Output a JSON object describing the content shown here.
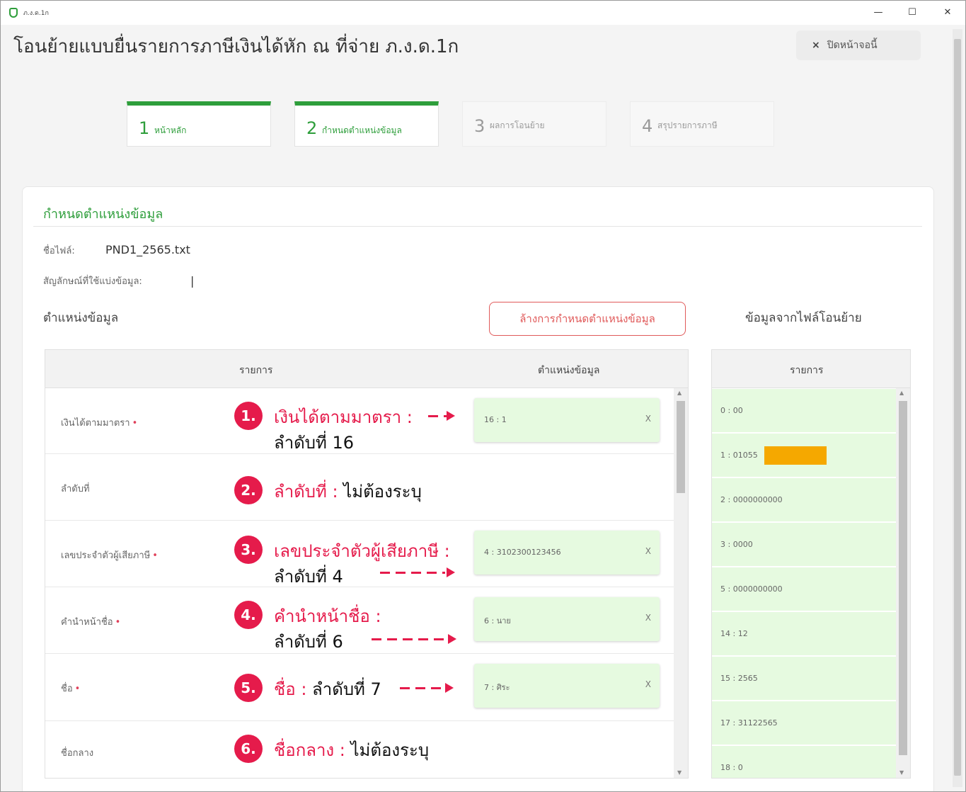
{
  "window": {
    "app_title": "ภ.ง.ด.1ก",
    "minimize": "—",
    "maximize": "☐",
    "close": "✕"
  },
  "page": {
    "title": "โอนย้ายแบบยื่นรายการภาษีเงินได้หัก ณ ที่จ่าย ภ.ง.ด.1ก",
    "close_button": "ปิดหน้าจอนี้",
    "close_icon": "×"
  },
  "steps": [
    {
      "num": "1",
      "label": "หน้าหลัก"
    },
    {
      "num": "2",
      "label": "กำหนดตำแหน่งข้อมูล"
    },
    {
      "num": "3",
      "label": "ผลการโอนย้าย"
    },
    {
      "num": "4",
      "label": "สรุปรายการภาษี"
    }
  ],
  "section": {
    "title": "กำหนดตำแหน่งข้อมูล",
    "file_label": "ชื่อไฟล์:",
    "file_name": "PND1_2565.txt",
    "delimiter_label": "สัญลักษณ์ที่ใช้แบ่งข้อมูล:",
    "delimiter_value": "|",
    "positions_heading": "ตำแหน่งข้อมูล",
    "clear_button": "ล้างการกำหนดตำแหน่งข้อมูล",
    "source_heading": "ข้อมูลจากไฟล์โอนย้าย"
  },
  "mapping_table": {
    "col_item": "รายการ",
    "col_position": "ตำแหน่งข้อมูล",
    "required_mark": "•",
    "rows": [
      {
        "label": "เงินได้ตามมาตรา",
        "required": true,
        "slot": "16 : 1",
        "remove": "X"
      },
      {
        "label": "ลำดับที่",
        "required": false,
        "slot": "",
        "remove": ""
      },
      {
        "label": "เลขประจำตัวผู้เสียภาษี",
        "required": true,
        "slot": "4 : 3102300123456",
        "remove": "X"
      },
      {
        "label": "คำนำหน้าชื่อ",
        "required": true,
        "slot": "6 : นาย",
        "remove": "X"
      },
      {
        "label": "ชื่อ",
        "required": true,
        "slot": "7 : ศิระ",
        "remove": "X"
      },
      {
        "label": "ชื่อกลาง",
        "required": false,
        "slot": "",
        "remove": ""
      }
    ]
  },
  "source_table": {
    "col_item": "รายการ",
    "rows": [
      "0 : 00",
      "1 : 01055",
      "2 : 0000000000",
      "3 : 0000",
      "5 : 0000000000",
      "14 : 12",
      "15 : 2565",
      "17 : 31122565",
      "18 : 0"
    ]
  },
  "annotations": [
    {
      "num": "1.",
      "red": "เงินได้ตามมาตรา :",
      "black": "",
      "sub": "ลำดับที่ 16"
    },
    {
      "num": "2.",
      "red": "ลำดับที่  :",
      "black": " ไม่ต้องระบุ",
      "sub": ""
    },
    {
      "num": "3.",
      "red": "เลขประจำตัวผู้เสียภาษี :",
      "black": "",
      "sub": "ลำดับที่ 4"
    },
    {
      "num": "4.",
      "red": "คำนำหน้าชื่อ  :",
      "black": "",
      "sub": "ลำดับที่ 6"
    },
    {
      "num": "5.",
      "red": "ชื่อ  :",
      "black": " ลำดับที่ 7",
      "sub": ""
    },
    {
      "num": "6.",
      "red": "ชื่อกลาง :",
      "black": "  ไม่ต้องระบุ",
      "sub": ""
    }
  ],
  "colors": {
    "accent_green": "#2e9e3b",
    "slot_green": "#e6fae0",
    "annotation_red": "#e51b4b",
    "highlight_orange": "#f5a800"
  }
}
